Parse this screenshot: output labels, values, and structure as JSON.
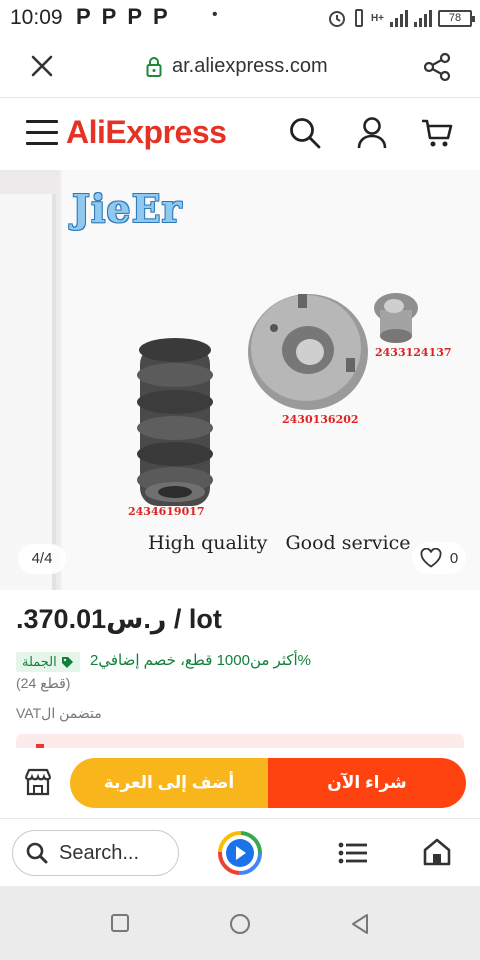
{
  "status_bar": {
    "time": "10:09",
    "notifications": "PPPP",
    "network": "H+",
    "battery": "78"
  },
  "url_bar": {
    "url": "ar.aliexpress.com"
  },
  "site_header": {
    "logo": "AliExpress"
  },
  "gallery": {
    "brand_watermark": "JieEr",
    "part_numbers": [
      "2433124137",
      "2430136202",
      "2434619017"
    ],
    "tagline": "High quality   Good service",
    "counter": "4/4",
    "favorites_count": "0"
  },
  "product": {
    "price": ".ر.س370.01 / lot",
    "wholesale_badge": "الجملة",
    "discount_text": "%أكثر من1000 قطع، خصم إضافي2",
    "pieces": "(قطع 24)",
    "vat": "VATمتضمن ال"
  },
  "actions": {
    "add_to_cart": "أضف إلى العربة",
    "buy_now": "شراء الآن"
  },
  "browser_bar": {
    "search_label": "Search..."
  },
  "colors": {
    "brand_red": "#e43225",
    "cart_button": "#f9b51c",
    "buy_button": "#ff4310",
    "wholesale_green": "#11803a"
  }
}
